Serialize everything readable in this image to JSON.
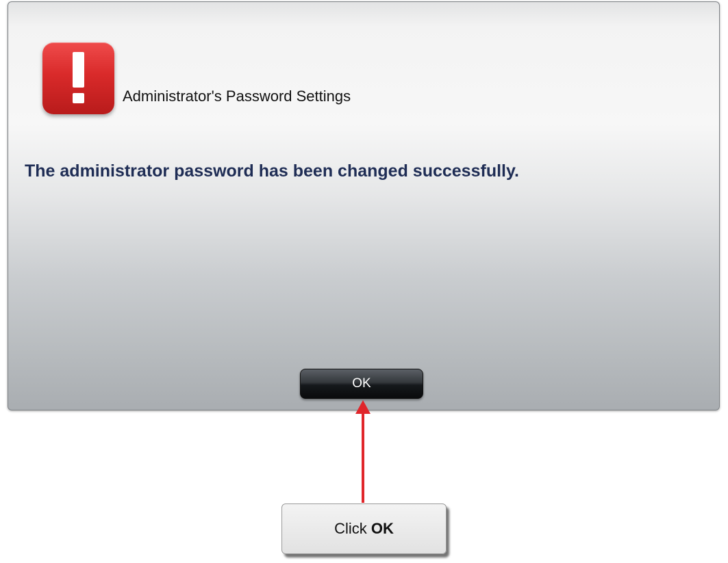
{
  "dialog": {
    "title": "Administrator's Password Settings",
    "message": "The administrator password has been changed successfully.",
    "icon": "exclamation-icon",
    "ok_label": "OK"
  },
  "callout": {
    "prefix": "Click ",
    "emphasis": "OK"
  },
  "colors": {
    "alert_red": "#d92a2a",
    "message_text": "#1f2d55",
    "arrow": "#e0262b",
    "button_dark": "#15181b"
  }
}
